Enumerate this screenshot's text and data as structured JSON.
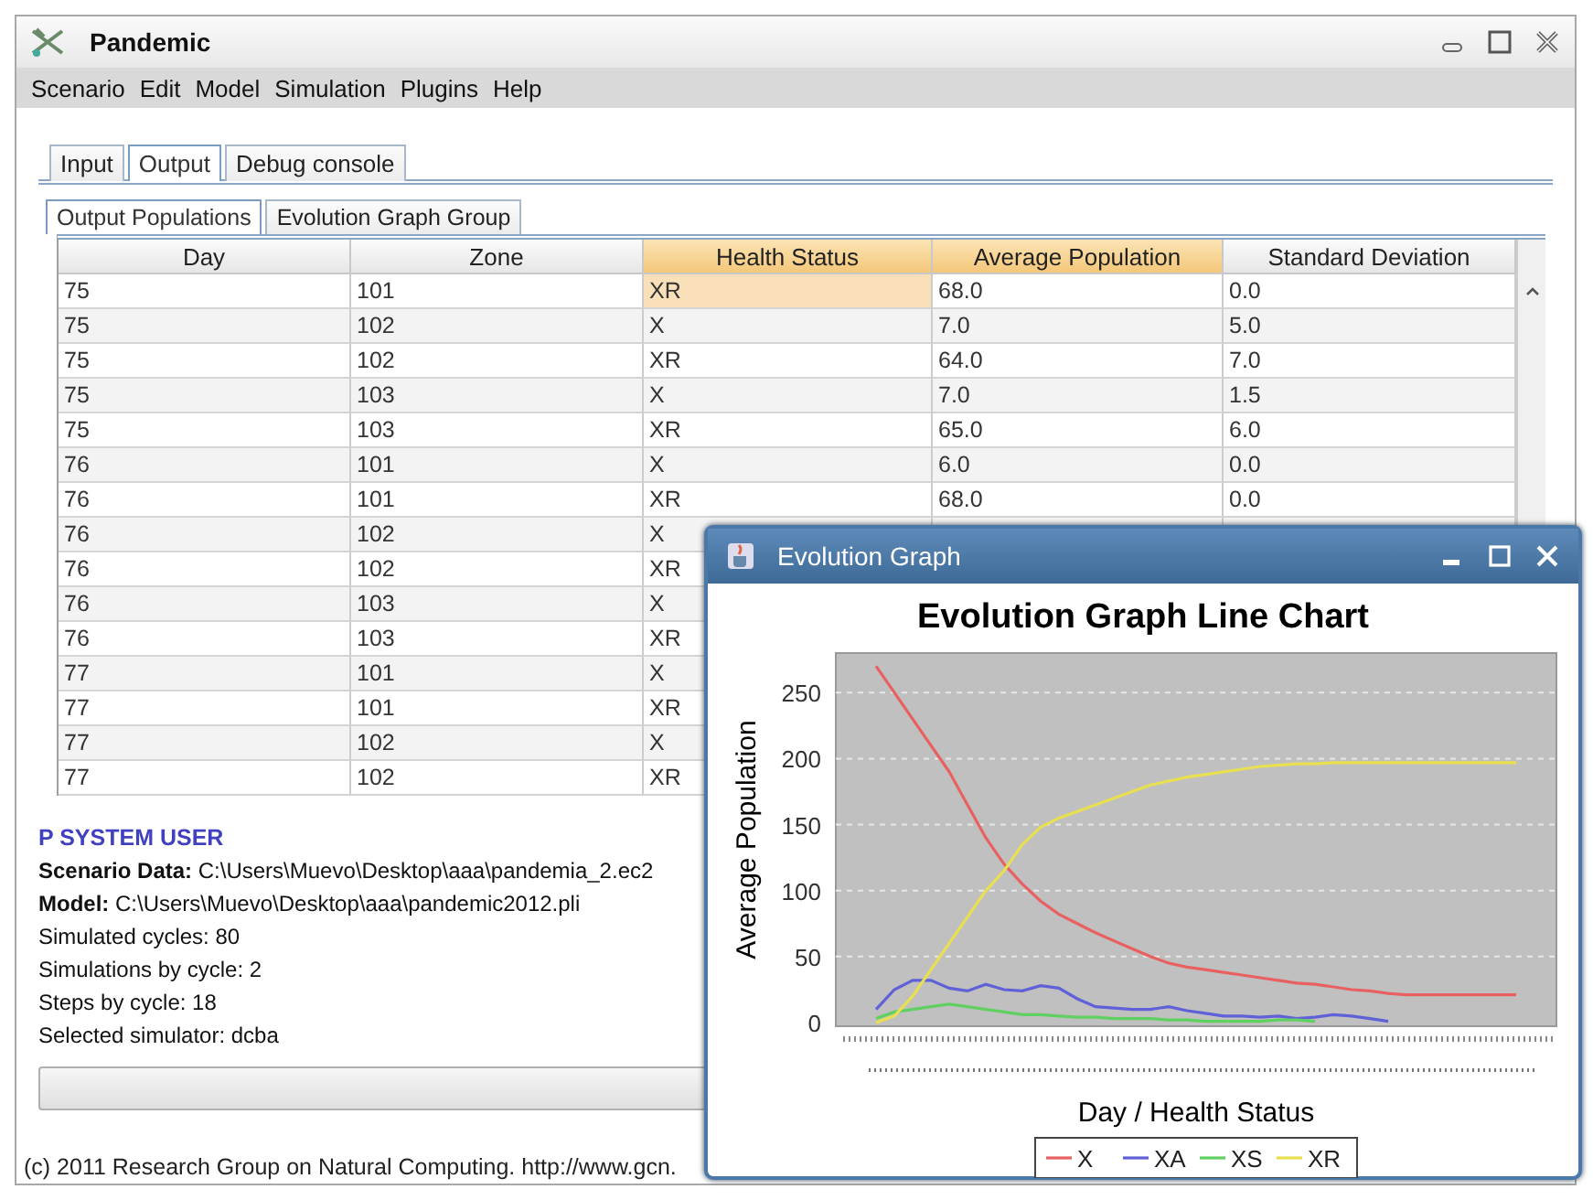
{
  "window": {
    "title": "Pandemic"
  },
  "menu": [
    "Scenario",
    "Edit",
    "Model",
    "Simulation",
    "Plugins",
    "Help"
  ],
  "tabs": [
    {
      "label": "Input",
      "selected": false
    },
    {
      "label": "Output",
      "selected": true
    },
    {
      "label": "Debug console",
      "selected": false
    }
  ],
  "subtabs": [
    {
      "label": "Output Populations",
      "selected": true
    },
    {
      "label": "Evolution Graph Group",
      "selected": false
    }
  ],
  "table": {
    "columns": [
      {
        "label": "Day",
        "highlighted": false
      },
      {
        "label": "Zone",
        "highlighted": false
      },
      {
        "label": "Health Status",
        "highlighted": true
      },
      {
        "label": "Average Population",
        "highlighted": true
      },
      {
        "label": "Standard Deviation",
        "highlighted": false
      }
    ],
    "rows": [
      {
        "cells": [
          "75",
          "101",
          "XR",
          "68.0",
          "0.0"
        ],
        "selected": true
      },
      {
        "cells": [
          "75",
          "102",
          "X",
          "7.0",
          "5.0"
        ],
        "selected": false
      },
      {
        "cells": [
          "75",
          "102",
          "XR",
          "64.0",
          "7.0"
        ],
        "selected": false
      },
      {
        "cells": [
          "75",
          "103",
          "X",
          "7.0",
          "1.5"
        ],
        "selected": false
      },
      {
        "cells": [
          "75",
          "103",
          "XR",
          "65.0",
          "6.0"
        ],
        "selected": false
      },
      {
        "cells": [
          "76",
          "101",
          "X",
          "6.0",
          "0.0"
        ],
        "selected": false
      },
      {
        "cells": [
          "76",
          "101",
          "XR",
          "68.0",
          "0.0"
        ],
        "selected": false
      },
      {
        "cells": [
          "76",
          "102",
          "X"
        ],
        "selected": false
      },
      {
        "cells": [
          "76",
          "102",
          "XR"
        ],
        "selected": false
      },
      {
        "cells": [
          "76",
          "103",
          "X"
        ],
        "selected": false
      },
      {
        "cells": [
          "76",
          "103",
          "XR"
        ],
        "selected": false
      },
      {
        "cells": [
          "77",
          "101",
          "X"
        ],
        "selected": false
      },
      {
        "cells": [
          "77",
          "101",
          "XR"
        ],
        "selected": false
      },
      {
        "cells": [
          "77",
          "102",
          "X"
        ],
        "selected": false
      },
      {
        "cells": [
          "77",
          "102",
          "XR"
        ],
        "selected": false
      }
    ]
  },
  "info": {
    "heading": "P SYSTEM USER",
    "lines": [
      "**Scenario Data:** C:\\Users\\Muevo\\Desktop\\aaa\\pandemia_2.ec2",
      "**Model:** C:\\Users\\Muevo\\Desktop\\aaa\\pandemic2012.pli",
      "Simulated cycles: 80",
      "Simulations by cycle: 2",
      "Steps by cycle: 18",
      "Selected simulator: dcba"
    ]
  },
  "progress": {
    "level": 0
  },
  "footer": "(c) 2011 Research Group on Natural Computing. http://www.gcn.",
  "graph_window": {
    "title": "Evolution Graph",
    "chart_data": {
      "type": "line",
      "title": "Evolution Graph Line Chart",
      "xlabel": "Day / Health Status",
      "ylabel": "Average Population",
      "ylim": [
        0,
        280
      ],
      "grid": true,
      "legend": "bottom",
      "yticks": [
        0,
        50,
        100,
        150,
        200,
        250
      ],
      "series": [
        {
          "name": "X",
          "color": "#e86060",
          "values": [
            270,
            250,
            230,
            210,
            190,
            165,
            140,
            120,
            105,
            92,
            82,
            75,
            68,
            62,
            56,
            50,
            45,
            42,
            40,
            38,
            36,
            34,
            32,
            30,
            29,
            27,
            25,
            24,
            22,
            21,
            21,
            21,
            21,
            21,
            21,
            21
          ]
        },
        {
          "name": "XA",
          "color": "#6060d8",
          "values": [
            10,
            25,
            32,
            32,
            26,
            24,
            29,
            25,
            24,
            28,
            26,
            18,
            12,
            11,
            10,
            10,
            12,
            9,
            7,
            5,
            5,
            4,
            5,
            3,
            4,
            6,
            5,
            3,
            1,
            null,
            null,
            null,
            null,
            null,
            null,
            null
          ]
        },
        {
          "name": "XS",
          "color": "#60d060",
          "values": [
            3,
            8,
            10,
            12,
            14,
            12,
            10,
            8,
            6,
            6,
            5,
            4,
            4,
            3,
            3,
            3,
            2,
            2,
            1,
            1,
            1,
            1,
            2,
            2,
            1,
            null,
            null,
            null,
            null,
            null,
            null,
            null,
            null,
            null,
            null,
            null
          ]
        },
        {
          "name": "XR",
          "color": "#e8e050",
          "values": [
            0,
            5,
            20,
            40,
            60,
            80,
            100,
            115,
            135,
            148,
            155,
            160,
            165,
            170,
            175,
            180,
            183,
            186,
            188,
            190,
            192,
            194,
            195,
            196,
            196,
            197,
            197,
            197,
            197,
            197,
            197,
            197,
            197,
            197,
            197,
            197
          ]
        }
      ]
    }
  }
}
